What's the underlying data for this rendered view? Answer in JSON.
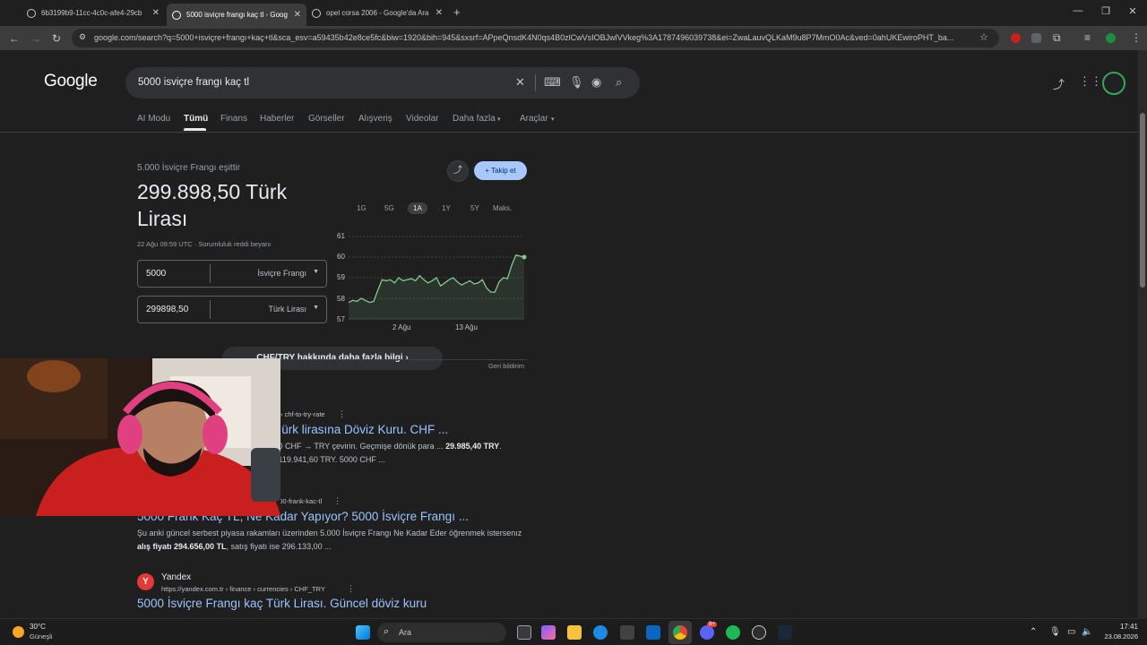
{
  "browser": {
    "tabs": [
      {
        "title": "6b3199b9-11cc-4c0c-afe4-29cb",
        "active": false
      },
      {
        "title": "5000 isviçre frangı kaç tl - Goog",
        "active": true
      },
      {
        "title": "opel corsa 2006 - Google'da Ara",
        "active": false
      }
    ],
    "new_tab": "+",
    "url": "google.com/search?q=5000+isviçre+frangı+kaç+tl&sca_esv=a59435b42e8ce5fc&biw=1920&bih=945&sxsrf=APpeQnsdK4N0qs4B0zlCwVsIOBJwlVVkeg%3A1787496039738&ei=ZwaLauvQLKaM9u8P7MmO0Ac&ved=0ahUKEwiroPHT_ba..."
  },
  "google": {
    "logo": "Google",
    "query": "5000 isviçre frangı kaç tl",
    "tabs": [
      "AI Modu",
      "Tümü",
      "Finans",
      "Haberler",
      "Görseller",
      "Alışveriş",
      "Videolar",
      "Daha fazla",
      "Araçlar"
    ]
  },
  "converter": {
    "subtitle": "5.000 İsviçre Frangı eşittir",
    "result": "299.898,50 Türk Lirası",
    "date": "22 Ağu 09:59 UTC · Sorumluluk reddi beyanı",
    "from_value": "5000",
    "from_currency": "İsviçre Frangı",
    "to_value": "299898,50",
    "to_currency": "Türk Lirası",
    "follow_label": "Takip et",
    "ranges": [
      "1G",
      "5G",
      "1A",
      "1Y",
      "5Y",
      "Maks."
    ],
    "selected_range": "1A",
    "more_info": "CHF/TRY hakkında daha fazla bilgi",
    "feedback": "Geri bildirim"
  },
  "chart_data": {
    "type": "line",
    "x_ticks": [
      "2 Ağu",
      "13 Ağu"
    ],
    "y_ticks": [
      57,
      58,
      59,
      60,
      61
    ],
    "ylim": [
      57,
      61
    ],
    "color": "#81c995",
    "values": [
      57.8,
      57.9,
      57.85,
      58.0,
      57.9,
      57.8,
      57.85,
      58.4,
      58.9,
      58.85,
      58.9,
      58.75,
      59.0,
      58.85,
      58.9,
      58.95,
      58.85,
      59.1,
      58.9,
      58.75,
      58.85,
      59.0,
      58.6,
      58.75,
      58.9,
      59.0,
      58.8,
      58.65,
      58.75,
      58.85,
      58.7,
      58.75,
      58.9,
      58.5,
      58.3,
      58.3,
      58.8,
      59.0,
      58.95,
      59.6,
      60.1,
      60.05,
      60.0
    ]
  },
  "results": [
    {
      "url_tail": "› chf-to-try-rate",
      "title": "...ürk lirasına Döviz Kuru. CHF ...",
      "snippet_a": "...0 CHF → TRY çevirin. Geçmişe dönük para ... ",
      "snippet_b": "29.985,40 TRY",
      "snippet_c": ". ...119.941,60 TRY. 5000 CHF ..."
    },
    {
      "url_tail": "...00-frank-kac-tl",
      "title": "5000 Frank Kaç TL, Ne Kadar Yapıyor? 5000 İsviçre Frangı ...",
      "snippet_a": "Şu anki güncel serbest piyasa rakamları üzerinden 5.000 İsviçre Frangı Ne Kadar Eder öğrenmek istersenız ",
      "snippet_b": "alış fiyatı 294.656,00 TL",
      "snippet_c": ", satış fiyatı ise 296.133,00 ..."
    },
    {
      "site": "Yandex",
      "favicon": "Y",
      "url": "https://yandex.com.tr › finance › currencies › CHF_TRY",
      "title": "5000 İsviçre Frangı kaç Türk Lirası. Güncel döviz kuru"
    }
  ],
  "taskbar": {
    "weather_temp": "30°C",
    "weather_text": "Güneşli",
    "search_placeholder": "Ara",
    "time": "17:41",
    "date": "23.08.2026",
    "discord_badge": "9+"
  }
}
